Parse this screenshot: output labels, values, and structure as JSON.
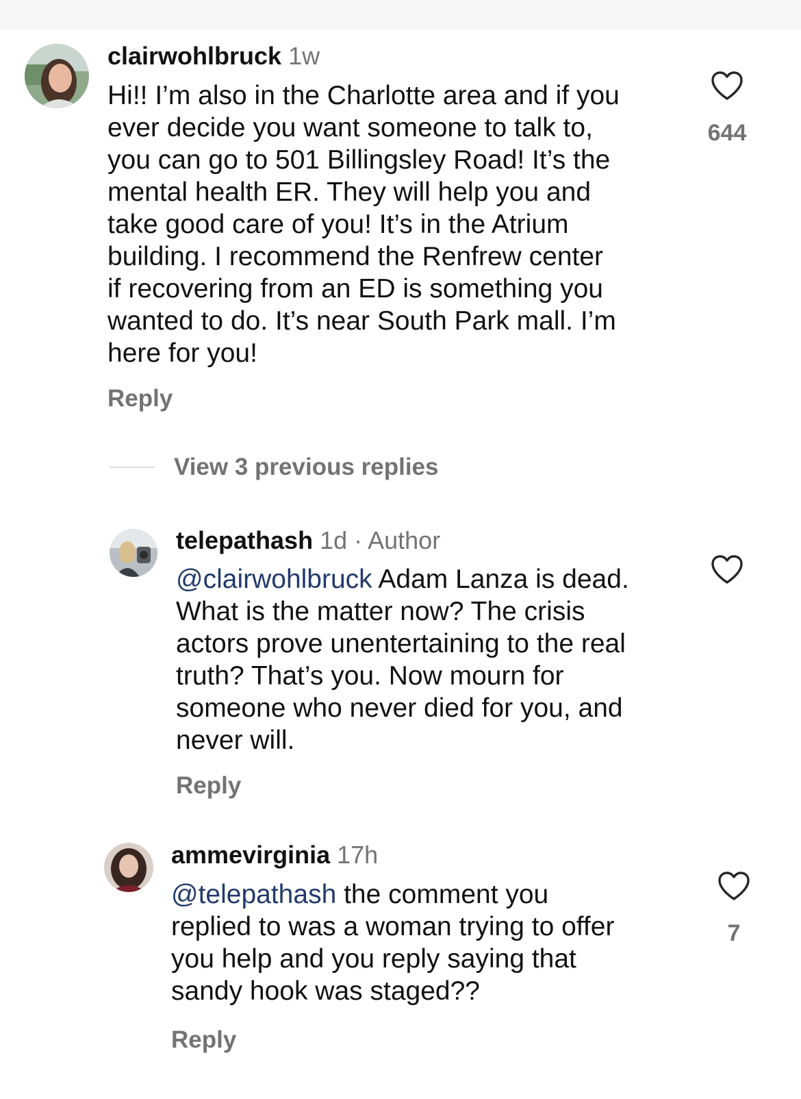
{
  "comments": [
    {
      "username": "clairwohlbruck",
      "time": "1w",
      "lines": [
        "Hi!! I’m also in the Charlotte area and if you",
        "ever decide you want someone to talk to,",
        "you can go to 501 Billingsley Road! It’s the",
        "mental health ER. They will help you and",
        "take good care of you! It’s in the Atrium",
        "building. I recommend the Renfrew center",
        "if recovering from an ED is something you",
        "wanted to do. It’s near South Park mall. I’m",
        "here for you!"
      ],
      "reply_label": "Reply",
      "like_count": "644"
    },
    {
      "username": "telepathash",
      "time": "1d · Author",
      "mention": "@clairwohlbruck",
      "first_line_rest": " Adam Lanza is dead.",
      "lines": [
        "What is the matter now? The crisis",
        "actors prove unentertaining to the real",
        "truth? That’s you. Now mourn for",
        "someone who never died for you, and",
        "never will."
      ],
      "reply_label": "Reply"
    },
    {
      "username": "ammevirginia",
      "time": "17h",
      "mention": "@telepathash",
      "first_line_rest": " the comment you",
      "lines": [
        "replied to was a woman trying to offer",
        "you help and you reply saying that",
        "sandy hook was staged??"
      ],
      "reply_label": "Reply",
      "like_count": "7"
    }
  ],
  "view_replies": "View 3 previous replies",
  "colors": {
    "secondary_text": "#737373",
    "mention": "#223a6b",
    "divider": "#dbdbdb"
  },
  "icons": {
    "like": "heart-outline-icon"
  }
}
